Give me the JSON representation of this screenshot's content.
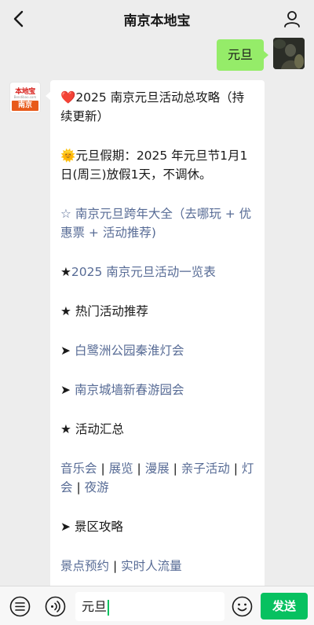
{
  "header": {
    "title": "南京本地宝",
    "back_icon": "chevron-left-icon",
    "profile_icon": "person-icon"
  },
  "outgoing": {
    "text": "元旦",
    "bubble_color": "#95ec69"
  },
  "incoming": {
    "avatar": {
      "logo_top": "本地宝",
      "logo_sub": "Bendibao.com",
      "logo_bottom": "南京",
      "accent_color": "#e85a1a"
    },
    "heart_icon": "❤️",
    "headline": "2025 南京元旦活动总攻略（持续更新）",
    "sun_icon": "🌞",
    "holiday_text": "元旦假期：2025 年元旦节1月1日(周三)放假1天，不调休。",
    "star_outline": "☆",
    "link_countdown": "南京元旦跨年大全（去哪玩 + 优惠票 + 活动推荐)",
    "star_solid": "★",
    "link_list": "2025 南京元旦活动一览表",
    "hot_heading": "★ 热门活动推荐",
    "arrow": "➤",
    "link_bailuzhou": "白鹭洲公园秦淮灯会",
    "link_citywall": "南京城墙新春游园会",
    "summary_heading": "★ 活动汇总",
    "summary_links": [
      "音乐会",
      "展览",
      "漫展",
      "亲子活动",
      "灯会",
      "夜游"
    ],
    "scenic_heading": "➤ 景区攻略",
    "scenic_links": [
      "景点预约",
      "实时人流量"
    ],
    "link_color": "#576b95"
  },
  "input_bar": {
    "voice_icon": "voice-list-icon",
    "audio_icon": "sound-wave-icon",
    "input_value": "元旦",
    "emoji_icon": "smiley-icon",
    "send_label": "发送",
    "send_color": "#07c160"
  }
}
